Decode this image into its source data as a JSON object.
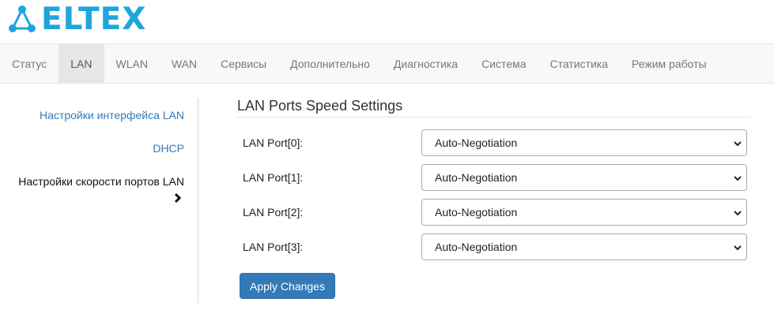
{
  "brand": {
    "name": "ELTEX",
    "icon": "eltex-network-logo-icon",
    "color": "#1fa5dc"
  },
  "nav": {
    "items": [
      {
        "label": "Статус",
        "active": false
      },
      {
        "label": "LAN",
        "active": true
      },
      {
        "label": "WLAN",
        "active": false
      },
      {
        "label": "WAN",
        "active": false
      },
      {
        "label": "Сервисы",
        "active": false
      },
      {
        "label": "Дополнительно",
        "active": false
      },
      {
        "label": "Диагностика",
        "active": false
      },
      {
        "label": "Система",
        "active": false
      },
      {
        "label": "Статистика",
        "active": false
      },
      {
        "label": "Режим работы",
        "active": false
      }
    ]
  },
  "sidebar": {
    "items": [
      {
        "label": "Настройки интерфейса LAN",
        "active": false
      },
      {
        "label": "DHCP",
        "active": false
      },
      {
        "label": "Настройки скорости портов LAN",
        "active": true,
        "icon": "chevron-right-icon"
      }
    ]
  },
  "main": {
    "title": "LAN Ports Speed Settings",
    "ports": [
      {
        "label": "LAN Port[0]:",
        "value": "Auto-Negotiation"
      },
      {
        "label": "LAN Port[1]:",
        "value": "Auto-Negotiation"
      },
      {
        "label": "LAN Port[2]:",
        "value": "Auto-Negotiation"
      },
      {
        "label": "LAN Port[3]:",
        "value": "Auto-Negotiation"
      }
    ],
    "apply_label": "Apply Changes"
  },
  "colors": {
    "accent": "#337ab7",
    "link": "#337ab7",
    "nav_bg": "#f8f8f8",
    "nav_active_bg": "#e7e7e7"
  }
}
